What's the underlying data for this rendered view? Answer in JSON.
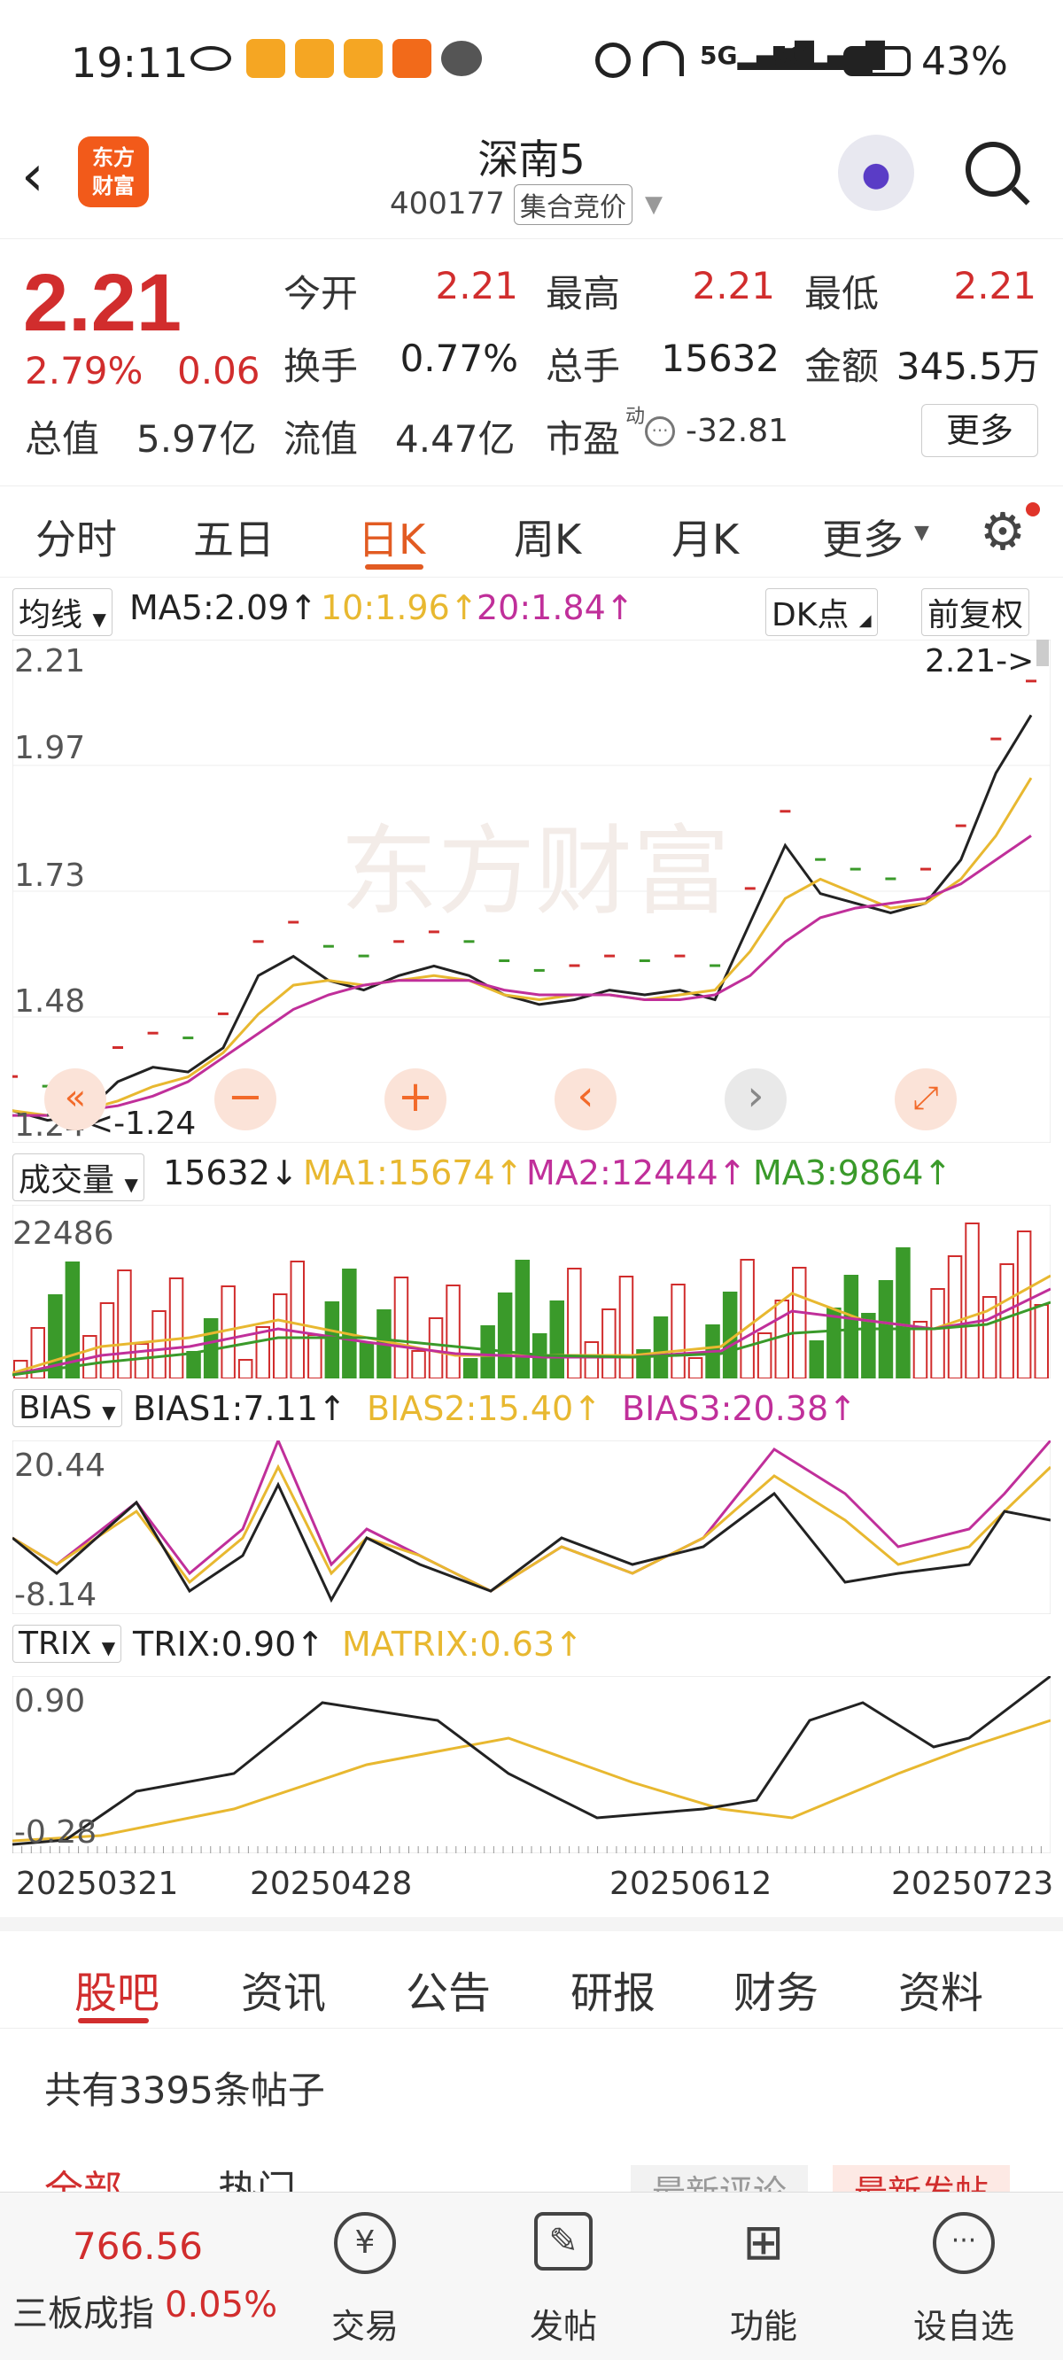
{
  "status_bar": {
    "time": "19:11",
    "battery": "43%",
    "network": "5G"
  },
  "header": {
    "logo_text": "东方\n财富",
    "title": "深南5",
    "code": "400177",
    "auction_tag": "集合竞价"
  },
  "quote": {
    "price": "2.21",
    "change_pct": "2.79%",
    "change": "0.06",
    "open_label": "今开",
    "open": "2.21",
    "high_label": "最高",
    "high": "2.21",
    "low_label": "最低",
    "low": "2.21",
    "turnover_label": "换手",
    "turnover": "0.77%",
    "volume_label": "总手",
    "volume": "15632",
    "amount_label": "金额",
    "amount": "345.5万",
    "mcap_label": "总值",
    "mcap": "5.97亿",
    "float_label": "流值",
    "float": "4.47亿",
    "pe_label": "市盈",
    "pe_sup": "动",
    "pe": "-32.81",
    "more_btn": "更多"
  },
  "tabs": [
    "分时",
    "五日",
    "日K",
    "周K",
    "月K",
    "更多"
  ],
  "active_tab": "日K",
  "kline": {
    "selector": "均线",
    "ma5": "MA5:2.09",
    "ma10": "10:1.96",
    "ma20": "20:1.84",
    "dk_btn": "DK点",
    "adjust_btn": "前复权",
    "y_top": "2.21",
    "y_2": "1.97",
    "y_3": "1.73",
    "y_4": "1.48",
    "y_bottom": "1.24",
    "max_marker": "2.21->",
    "min_marker": "<-1.24",
    "watermark": "东方财富"
  },
  "volume": {
    "selector": "成交量",
    "value": "15632",
    "ma1": "MA1:15674",
    "ma2": "MA2:12444",
    "ma3": "MA3:9864",
    "y_top": "22486"
  },
  "bias": {
    "selector": "BIAS",
    "bias1": "BIAS1:7.11",
    "bias2": "BIAS2:15.40",
    "bias3": "BIAS3:20.38",
    "y_top": "20.44",
    "y_bottom": "-8.14"
  },
  "trix": {
    "selector": "TRIX",
    "trix": "TRIX:0.90",
    "matrix": "MATRIX:0.63",
    "y_top": "0.90",
    "y_bottom": "-0.28"
  },
  "dates": [
    "20250321",
    "20250428",
    "20250612",
    "20250723"
  ],
  "subtabs": [
    "股吧",
    "资讯",
    "公告",
    "研报",
    "财务",
    "资料"
  ],
  "active_subtab": "股吧",
  "post_count": "共有3395条帖子",
  "post_filters": [
    "全部",
    "热门",
    "最新评论",
    "最新发帖"
  ],
  "bottom_nav": {
    "index_value": "766.56",
    "index_name": "三板成指",
    "index_change": "0.05%",
    "items": [
      "交易",
      "发帖",
      "功能",
      "设自选"
    ]
  },
  "colors": {
    "up": "#d12d2d",
    "down": "#3a9a2a",
    "ma10": "#e8b830",
    "ma20": "#c02f9a",
    "accent": "#e25b22"
  },
  "chart_data": [
    {
      "type": "line",
      "title": "日K",
      "series": [
        {
          "name": "MA5",
          "values": [
            1.27,
            1.25,
            1.26,
            1.33,
            1.36,
            1.35,
            1.4,
            1.55,
            1.59,
            1.54,
            1.52,
            1.55,
            1.57,
            1.55,
            1.51,
            1.49,
            1.5,
            1.52,
            1.51,
            1.52,
            1.5,
            1.66,
            1.82,
            1.72,
            1.7,
            1.68,
            1.7,
            1.79,
            1.97,
            2.09
          ]
        },
        {
          "name": "10",
          "values": [
            1.27,
            1.26,
            1.27,
            1.29,
            1.32,
            1.34,
            1.39,
            1.47,
            1.53,
            1.54,
            1.53,
            1.54,
            1.55,
            1.54,
            1.51,
            1.5,
            1.51,
            1.51,
            1.5,
            1.51,
            1.52,
            1.6,
            1.71,
            1.75,
            1.72,
            1.69,
            1.7,
            1.75,
            1.84,
            1.96
          ]
        },
        {
          "name": "20",
          "values": [
            1.26,
            1.26,
            1.27,
            1.28,
            1.3,
            1.33,
            1.38,
            1.43,
            1.48,
            1.51,
            1.53,
            1.54,
            1.54,
            1.54,
            1.52,
            1.51,
            1.51,
            1.51,
            1.5,
            1.5,
            1.51,
            1.55,
            1.62,
            1.67,
            1.69,
            1.7,
            1.71,
            1.74,
            1.79,
            1.84
          ]
        }
      ],
      "ylim": [
        1.24,
        2.21
      ]
    }
  ]
}
